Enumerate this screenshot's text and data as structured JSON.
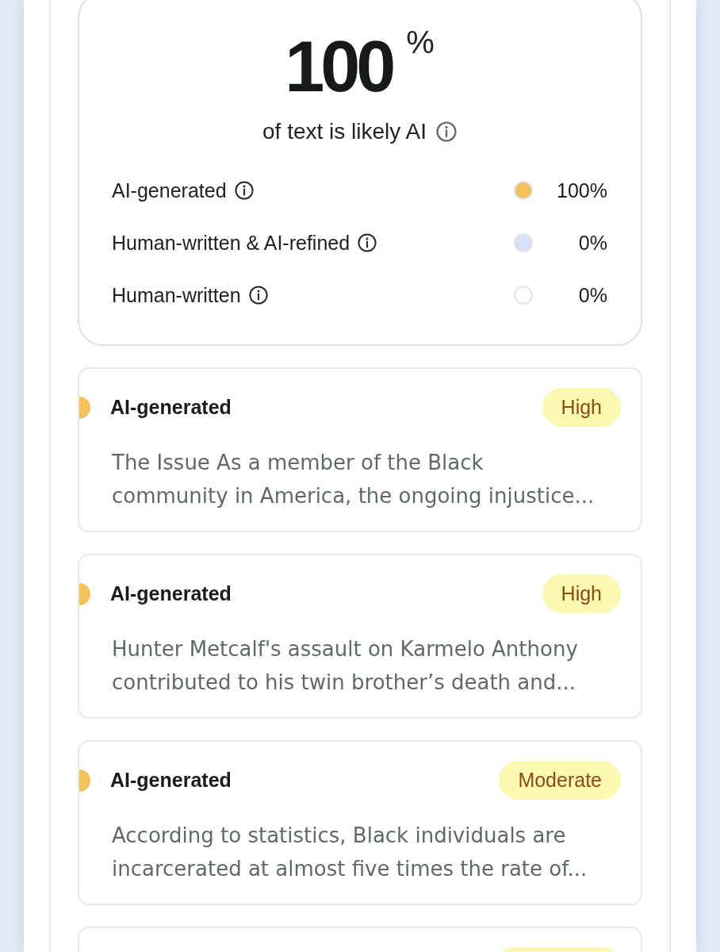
{
  "summary": {
    "score": "100",
    "score_unit": "%",
    "caption": "of text is likely AI",
    "categories": [
      {
        "label": "AI-generated",
        "color": "#f5c15c",
        "percent": "100%"
      },
      {
        "label": "Human-written & AI-refined",
        "color": "#d6e1f7",
        "percent": "0%"
      },
      {
        "label": "Human-written",
        "color": "#ffffff",
        "percent": "0%"
      }
    ]
  },
  "segments": [
    {
      "label": "AI-generated",
      "color": "#f5c15c",
      "likelihood": "High",
      "text": "The Issue As a member of the Black\ncommunity in America, the ongoing injustice..."
    },
    {
      "label": "AI-generated",
      "color": "#f5c15c",
      "likelihood": "High",
      "text": "Hunter Metcalf's assault on Karmelo Anthony\ncontributed to his twin brother’s death and..."
    },
    {
      "label": "AI-generated",
      "color": "#f5c15c",
      "likelihood": "Moderate",
      "text": "According to statistics, Black individuals are\nincarcerated at almost five times the rate of..."
    }
  ]
}
